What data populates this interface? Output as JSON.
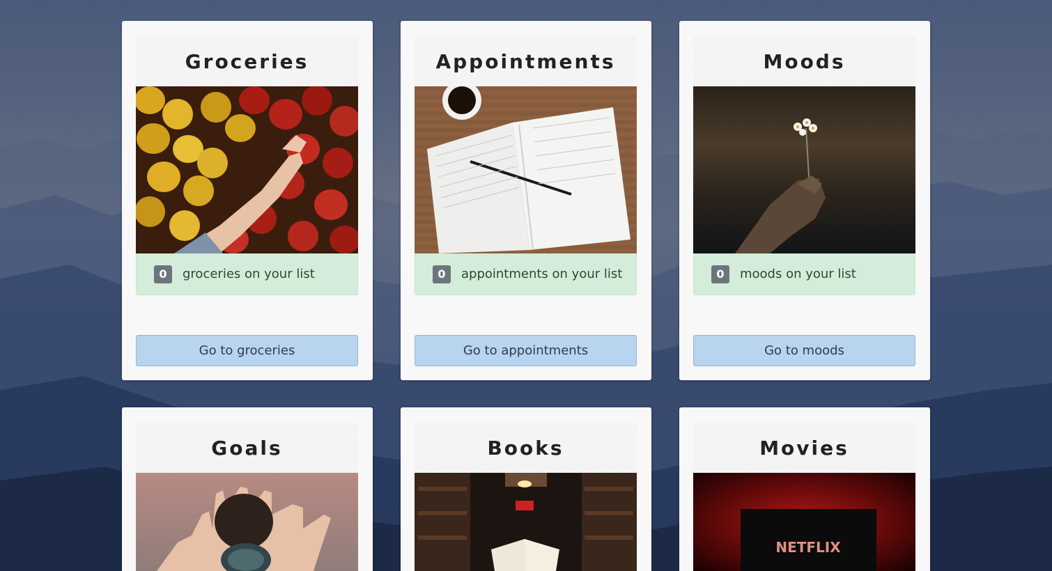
{
  "cards": [
    {
      "title": "Groceries",
      "count": "0",
      "count_label": "groceries on your list",
      "button_label": "Go to groceries",
      "image": "peppers-photo"
    },
    {
      "title": "Appointments",
      "count": "0",
      "count_label": "appointments on your list",
      "button_label": "Go to appointments",
      "image": "notebook-photo"
    },
    {
      "title": "Moods",
      "count": "0",
      "count_label": "moods on your list",
      "button_label": "Go to moods",
      "image": "flower-photo"
    },
    {
      "title": "Goals",
      "image": "compass-photo"
    },
    {
      "title": "Books",
      "image": "library-photo"
    },
    {
      "title": "Movies",
      "image": "netflix-photo",
      "image_text": "NETFLIX"
    }
  ],
  "colors": {
    "card_bg": "#f8f8f8",
    "count_bg": "#d4edda",
    "badge_bg": "#6c757d",
    "button_bg": "#b8d4ee"
  }
}
